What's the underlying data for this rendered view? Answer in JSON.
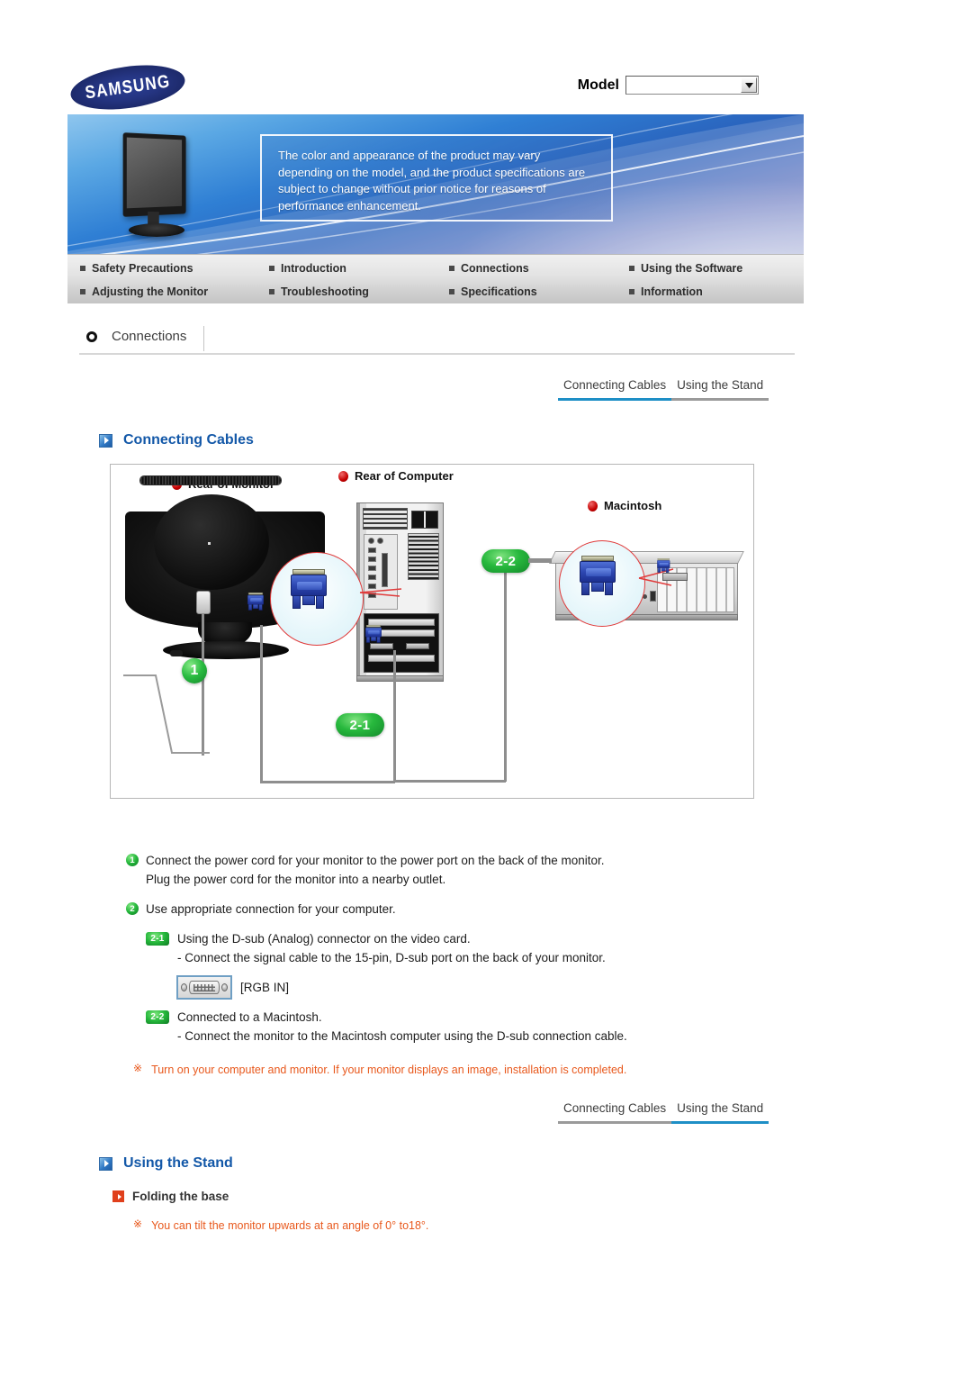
{
  "brand": {
    "logo_text": "SAMSUNG"
  },
  "model_selector": {
    "label": "Model",
    "value": "",
    "placeholder": ""
  },
  "banner": {
    "notice": "The color and appearance of the product may vary depending on the model, and the product specifications are subject to change without prior notice for reasons of performance enhancement."
  },
  "nav_menu": {
    "items": [
      {
        "label": "Safety Precautions"
      },
      {
        "label": "Introduction"
      },
      {
        "label": "Connections"
      },
      {
        "label": "Using the Software"
      },
      {
        "label": "Adjusting the Monitor"
      },
      {
        "label": "Troubleshooting"
      },
      {
        "label": "Specifications"
      },
      {
        "label": "Information"
      }
    ]
  },
  "section": {
    "title": "Connections"
  },
  "tabs_top": {
    "items": [
      {
        "label": "Connecting Cables",
        "active": true
      },
      {
        "label": "Using the Stand",
        "active": false
      }
    ]
  },
  "tabs_bottom": {
    "items": [
      {
        "label": "Connecting Cables",
        "active": false
      },
      {
        "label": "Using the Stand",
        "active": true
      }
    ]
  },
  "headings": {
    "connecting_cables": "Connecting Cables",
    "using_the_stand": "Using the Stand",
    "folding_the_base": "Folding the base"
  },
  "diagram": {
    "labels": {
      "rear_of_monitor": "Rear of Monitor",
      "rear_of_computer": "Rear of Computer",
      "macintosh": "Macintosh"
    },
    "badges": {
      "one": "1",
      "two_one": "2-1",
      "two_two": "2-2"
    }
  },
  "instructions": {
    "step1": {
      "badge": "1",
      "line1": "Connect the power cord for your monitor to the power port on the back of the monitor.",
      "line2": "Plug the power cord for the monitor into a nearby outlet."
    },
    "step2": {
      "badge": "2",
      "line1": "Use appropriate connection for your computer."
    },
    "step2_1": {
      "badge": "2-1",
      "line1": "Using the D-sub (Analog) connector on the video card.",
      "line2": "- Connect the signal cable to the 15-pin, D-sub port on the back of your monitor."
    },
    "rgb_in": {
      "icon": "dsub-port-icon",
      "label": "[RGB IN]"
    },
    "step2_2": {
      "badge": "2-2",
      "line1": "Connected to a Macintosh.",
      "line2": "- Connect the monitor to the Macintosh computer using the D-sub connection cable."
    },
    "note": {
      "mark": "※",
      "text": "Turn on your computer and monitor. If your monitor displays an image, installation is completed."
    }
  },
  "stand_section": {
    "note": {
      "mark": "※",
      "text": "You can tilt the monitor upwards at an angle of 0° to18°."
    }
  },
  "colors": {
    "brand_blue": "#253582",
    "heading_blue": "#1358a8",
    "active_tab": "#1e8fc6",
    "inactive_tab": "#9a9a9a",
    "note_orange": "#e8581c",
    "badge_green": "#27b83d",
    "sub_head_red": "#e0401c"
  }
}
